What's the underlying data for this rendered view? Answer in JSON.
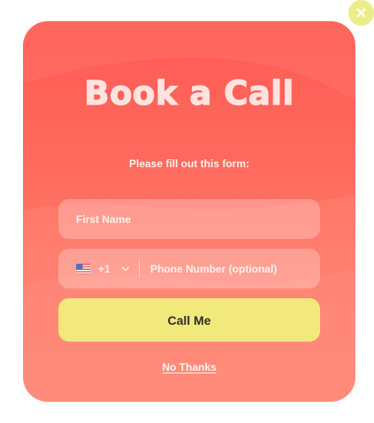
{
  "popup": {
    "title": "Book a Call",
    "subtitle": "Please fill out this form:",
    "close_icon": "close-icon",
    "fields": {
      "first_name": {
        "placeholder": "First Name",
        "value": ""
      },
      "phone": {
        "country_flag": "us-flag-icon",
        "dial_code": "+1",
        "dropdown_icon": "chevron-down-icon",
        "placeholder": "Phone Number (optional)",
        "value": ""
      }
    },
    "cta_label": "Call Me",
    "dismiss_label": "No Thanks"
  },
  "colors": {
    "gradient_top": "#ff5a55",
    "gradient_bottom": "#ff8b7a",
    "cta_background": "#f1e97b",
    "close_background": "#ecec8a",
    "text_light": "#fff3f0",
    "cta_text": "#2c2c2c"
  }
}
